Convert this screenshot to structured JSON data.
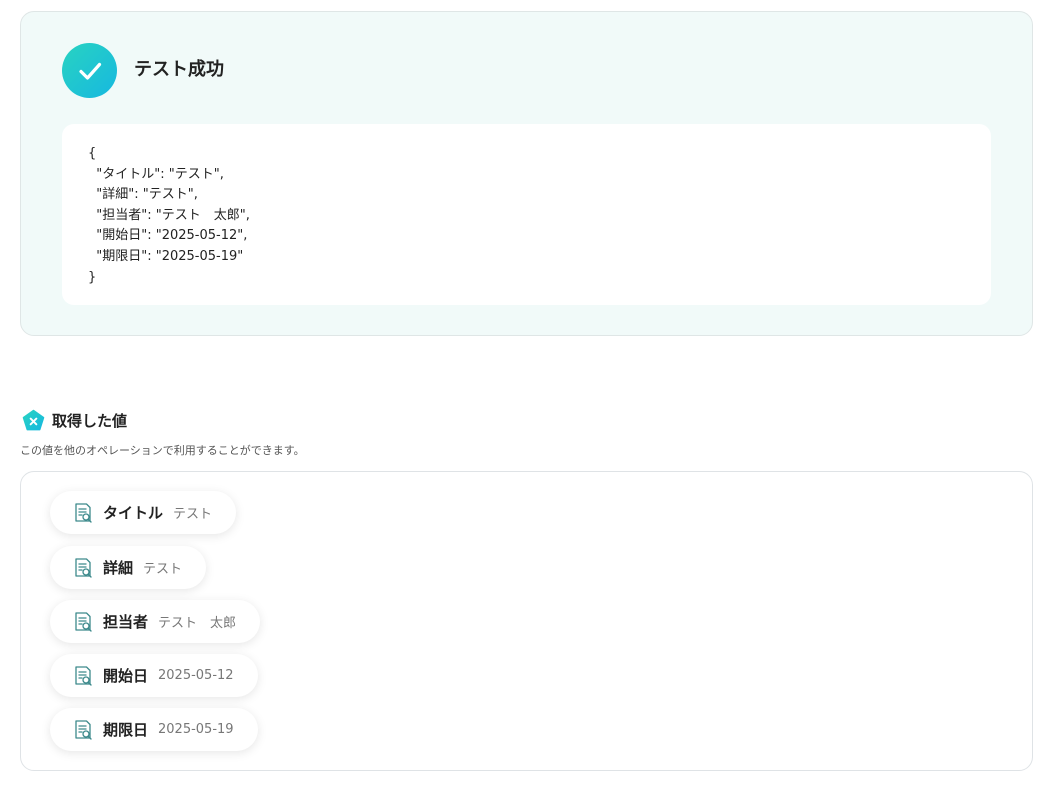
{
  "result": {
    "title": "テスト成功",
    "json_lines": [
      "{",
      "  \"タイトル\": \"テスト\",",
      "  \"詳細\": \"テスト\",",
      "  \"担当者\": \"テスト　太郎\",",
      "  \"開始日\": \"2025-05-12\",",
      "  \"期限日\": \"2025-05-19\"",
      "}"
    ]
  },
  "values_section": {
    "icon": "yoom-pentagon-icon",
    "title": "取得した値",
    "description": "この値を他のオペレーションで利用することができます。",
    "items": [
      {
        "label": "タイトル",
        "value": "テスト"
      },
      {
        "label": "詳細",
        "value": "テスト"
      },
      {
        "label": "担当者",
        "value": "テスト　太郎"
      },
      {
        "label": "開始日",
        "value": "2025-05-12"
      },
      {
        "label": "期限日",
        "value": "2025-05-19"
      }
    ]
  },
  "colors": {
    "panel_bg": "#f1faf9",
    "accent_start": "#28d3c1",
    "accent_end": "#17b8e0",
    "icon_teal": "#3d8a8c"
  }
}
